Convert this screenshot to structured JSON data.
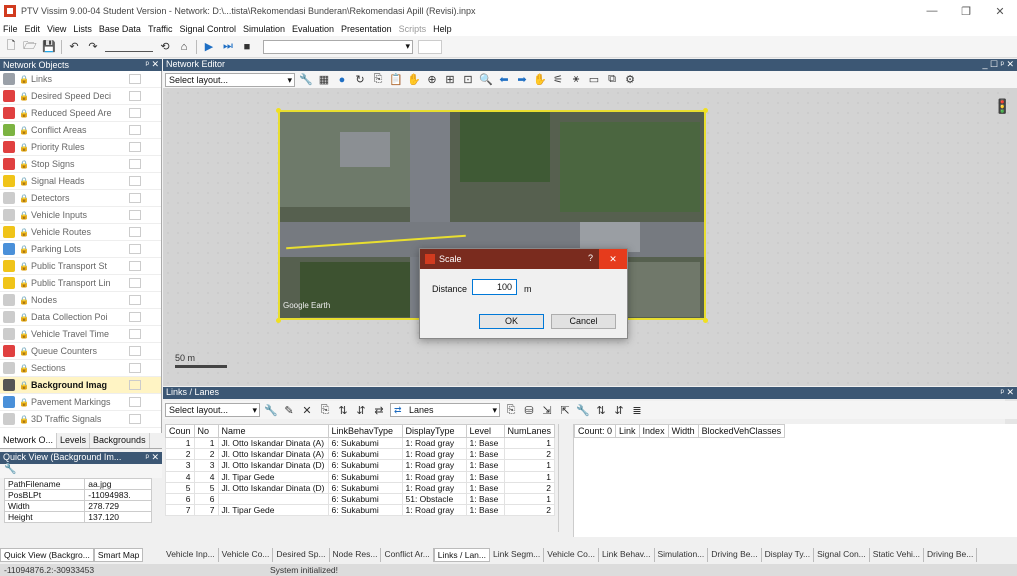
{
  "window": {
    "title": "PTV Vissim 9.00-04 Student Version - Network: D:\\...tista\\Rekomendasi Bunderan\\Rekomendasi Apill (Revisi).inpx"
  },
  "menu": [
    "File",
    "Edit",
    "View",
    "Lists",
    "Base Data",
    "Traffic",
    "Signal Control",
    "Simulation",
    "Evaluation",
    "Presentation",
    "Scripts",
    "Help"
  ],
  "network_objects": {
    "title": "Network Objects",
    "items": [
      {
        "label": "Links",
        "color": "#9aa0a8"
      },
      {
        "label": "Desired Speed Deci",
        "color": "#e04040"
      },
      {
        "label": "Reduced Speed Are",
        "color": "#e04040"
      },
      {
        "label": "Conflict Areas",
        "color": "#7cb342"
      },
      {
        "label": "Priority Rules",
        "color": "#e04040"
      },
      {
        "label": "Stop Signs",
        "color": "#e04040"
      },
      {
        "label": "Signal Heads",
        "color": "#f0c419"
      },
      {
        "label": "Detectors",
        "color": "#cccccc"
      },
      {
        "label": "Vehicle Inputs",
        "color": "#cccccc"
      },
      {
        "label": "Vehicle Routes",
        "color": "#f0c419"
      },
      {
        "label": "Parking Lots",
        "color": "#4a90d9"
      },
      {
        "label": "Public Transport St",
        "color": "#f0c419"
      },
      {
        "label": "Public Transport Lin",
        "color": "#f0c419"
      },
      {
        "label": "Nodes",
        "color": "#cccccc"
      },
      {
        "label": "Data Collection Poi",
        "color": "#cccccc"
      },
      {
        "label": "Vehicle Travel Time",
        "color": "#cccccc"
      },
      {
        "label": "Queue Counters",
        "color": "#e04040"
      },
      {
        "label": "Sections",
        "color": "#cccccc"
      },
      {
        "label": "Background Imag",
        "color": "#555555"
      },
      {
        "label": "Pavement Markings",
        "color": "#4a90d9"
      },
      {
        "label": "3D Traffic Signals",
        "color": "#cccccc"
      }
    ],
    "selected": "Background Imag"
  },
  "left_tabs": [
    "Network O...",
    "Levels",
    "Backgrounds"
  ],
  "quick_view": {
    "title": "Quick View (Background Im...",
    "rows": [
      {
        "key": "PathFilename",
        "value": "aa.jpg"
      },
      {
        "key": "PosBLPt",
        "value": "-11094983."
      },
      {
        "key": "Width",
        "value": "278.729"
      },
      {
        "key": "Height",
        "value": "137.120"
      }
    ]
  },
  "left_bottom_tabs": [
    "Quick View (Backgro...",
    "Smart Map"
  ],
  "network_editor": {
    "title": "Network Editor",
    "select_layout": "Select layout...",
    "image_label": "Google Earth",
    "scale_label": "50 m"
  },
  "scale_dialog": {
    "title": "Scale",
    "help": "?",
    "distance_label": "Distance",
    "distance_value": "100",
    "unit": "m",
    "ok": "OK",
    "cancel": "Cancel"
  },
  "links_lanes": {
    "title": "Links / Lanes",
    "select_layout": "Select layout...",
    "lanes_combo": "Lanes",
    "columns": [
      "Coun",
      "No",
      "Name",
      "LinkBehavType",
      "DisplayType",
      "Level",
      "NumLanes"
    ],
    "rows": [
      [
        "1",
        "1",
        "Jl. Otto Iskandar Dinata (A)",
        "6: Sukabumi",
        "1: Road gray",
        "1: Base",
        "1"
      ],
      [
        "2",
        "2",
        "Jl. Otto Iskandar Dinata (A)",
        "6: Sukabumi",
        "1: Road gray",
        "1: Base",
        "2"
      ],
      [
        "3",
        "3",
        "Jl. Otto Iskandar Dinata (D)",
        "6: Sukabumi",
        "1: Road gray",
        "1: Base",
        "1"
      ],
      [
        "4",
        "4",
        "Jl. Tipar Gede",
        "6: Sukabumi",
        "1: Road gray",
        "1: Base",
        "1"
      ],
      [
        "5",
        "5",
        "Jl. Otto Iskandar Dinata (D)",
        "6: Sukabumi",
        "1: Road gray",
        "1: Base",
        "2"
      ],
      [
        "6",
        "6",
        "",
        "6: Sukabumi",
        "51: Obstacle",
        "1: Base",
        "1"
      ],
      [
        "7",
        "7",
        "Jl. Tipar Gede",
        "6: Sukabumi",
        "1: Road gray",
        "1: Base",
        "2"
      ]
    ],
    "sub_columns": [
      "Count: 0",
      "Link",
      "Index",
      "Width",
      "BlockedVehClasses"
    ]
  },
  "bottom_tabs": [
    "Vehicle Inp...",
    "Vehicle Co...",
    "Desired Sp...",
    "Node Res...",
    "Conflict Ar...",
    "Links / Lan...",
    "Link Segm...",
    "Vehicle Co...",
    "Link Behav...",
    "Simulation...",
    "Driving Be...",
    "Display Ty...",
    "Signal Con...",
    "Static Vehi...",
    "Driving Be..."
  ],
  "active_bottom_tab": "Links / Lan...",
  "status": {
    "coords": "-11094876.2:-30933453",
    "message": "System initialized!"
  }
}
